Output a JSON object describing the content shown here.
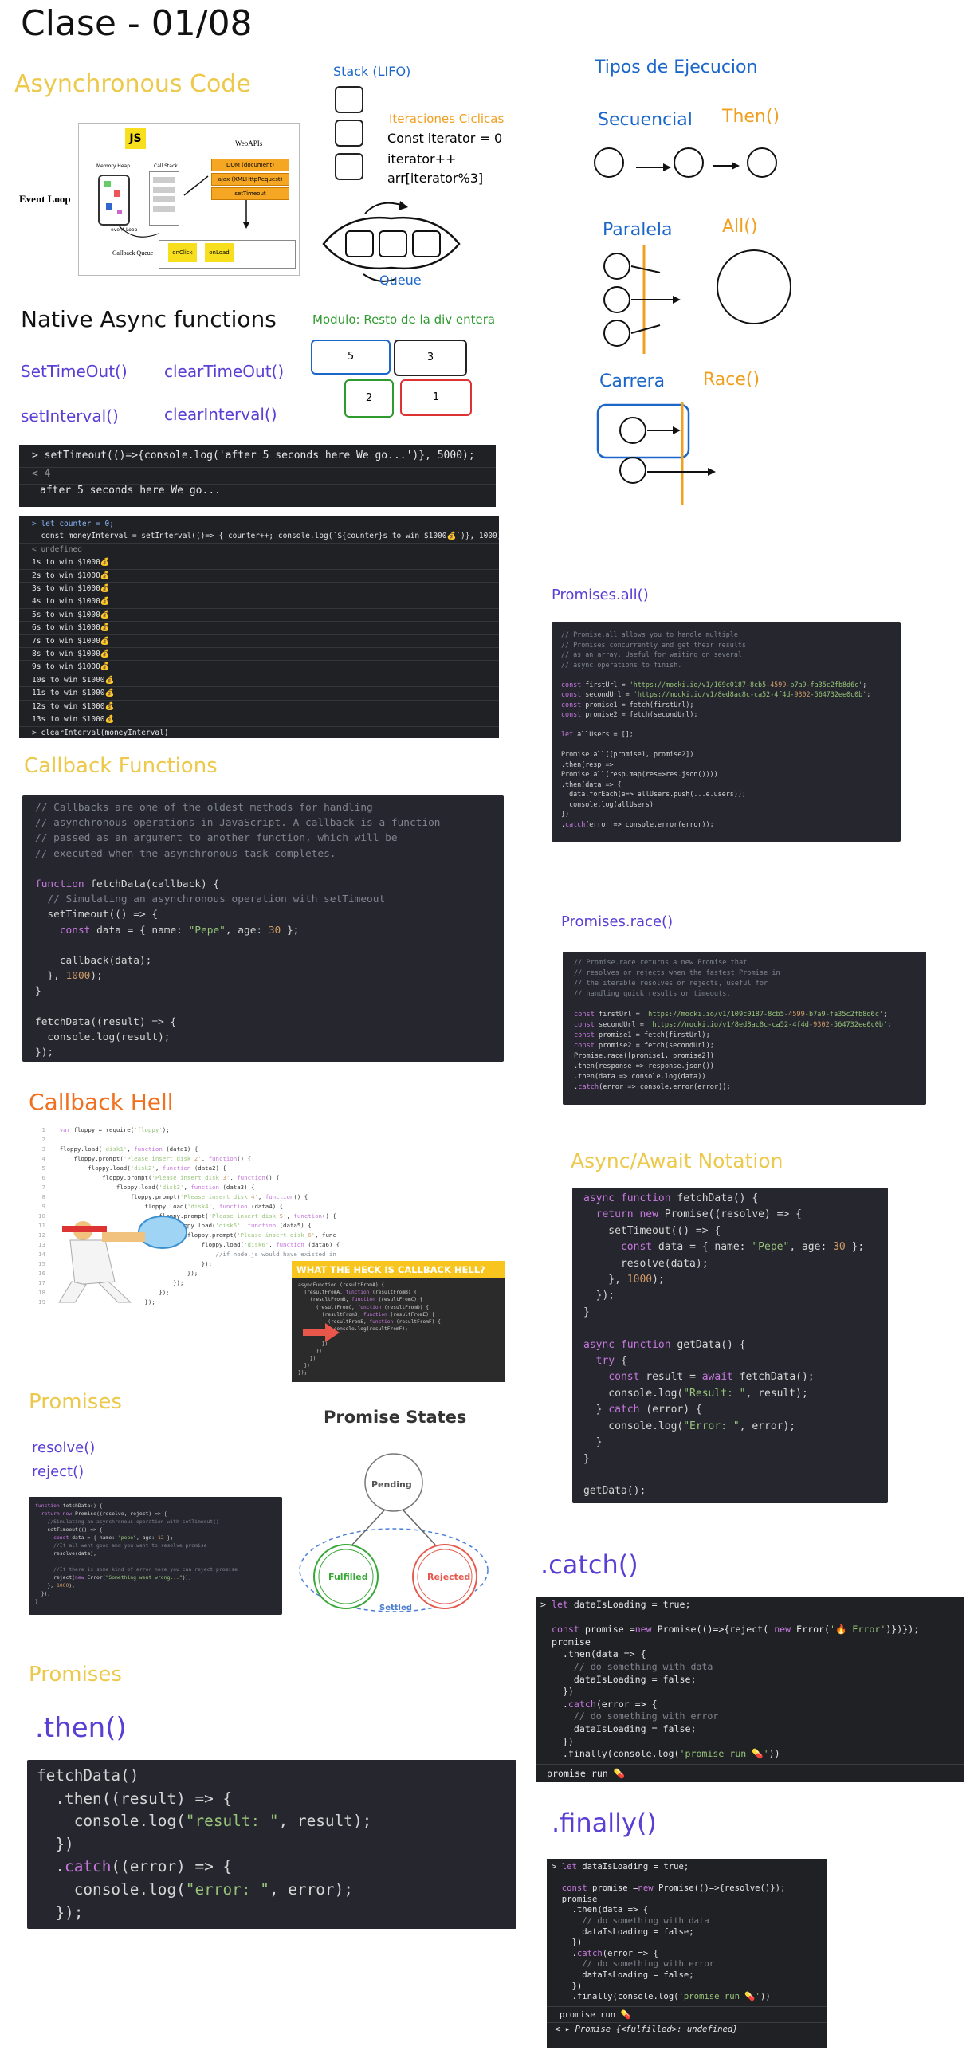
{
  "title": "Clase - 01/08",
  "async_code": {
    "heading": "Asynchronous Code",
    "event_loop_label": "Event Loop",
    "js_badge": "JS",
    "web_apis": "WebAPIs",
    "memory_heap": "Memory Heap",
    "call_stack": "Call Stack",
    "api_items": [
      "DOM (document)",
      "ajax (XMLHttpRequest)",
      "setTimeout"
    ],
    "event_loop_small": "event Loop",
    "callback_queue": "Callback Queue",
    "queue_items": [
      "onClick",
      "onLoad"
    ]
  },
  "stack": {
    "label": "Stack (LIFO)",
    "queue_label": "Queue"
  },
  "iteraciones": {
    "heading": "Iteraciones Ciclicas",
    "lines": [
      "Const iterator = 0",
      "iterator++",
      "arr[iterator%3]"
    ]
  },
  "tipos": {
    "heading": "Tipos de Ejecucion",
    "secuencial": "Secuencial",
    "then": "Then()",
    "paralela": "Paralela",
    "all": "All()",
    "carrera": "Carrera",
    "race": "Race()"
  },
  "native": {
    "heading": "Native Async functions",
    "items": [
      "SetTimeOut()",
      "clearTimeOut()",
      "setInterval()",
      "clearInterval()"
    ]
  },
  "modulo": {
    "heading": "Modulo: Resto de la div entera",
    "values": [
      "5",
      "3",
      "2",
      "1"
    ]
  },
  "console1": {
    "line1": "> setTimeout(()=>{console.log('after 5 seconds here We go...')}, 5000);",
    "line2": "< 4",
    "line3": "after 5 seconds here We go..."
  },
  "console2": {
    "header1": "> let counter = 0;",
    "header2": "  const moneyInterval = setInterval(()=> { counter++; console.log(`${counter}s to win $1000💰`)}, 1000);",
    "undefined": "< undefined",
    "lines": [
      "1s to win $1000💰",
      "2s to win $1000💰",
      "3s to win $1000💰",
      "4s to win $1000💰",
      "5s to win $1000💰",
      "6s to win $1000💰",
      "7s to win $1000💰",
      "8s to win $1000💰",
      "9s to win $1000💰",
      "10s to win $1000💰",
      "11s to win $1000💰",
      "12s to win $1000💰",
      "13s to win $1000💰"
    ],
    "footer": "> clearInterval(moneyInterval)"
  },
  "promises_all": {
    "heading": "Promises.all()",
    "code": [
      "// Promise.all allows you to handle multiple",
      "// Promises concurrently and get their results",
      "// as an array. Useful for waiting on several",
      "// async operations to finish.",
      "",
      "const firstUrl = 'https://mocki.io/v1/109c0187-8cb5-4599-b7a9-fa35c2fb8d6c';",
      "const secondUrl = 'https://mocki.io/v1/8ed8ac8c-ca52-4f4d-9302-564732ee0c0b';",
      "const promise1 = fetch(firstUrl);",
      "const promise2 = fetch(secondUrl);",
      "",
      "let allUsers = [];",
      "",
      "Promise.all([promise1, promise2])",
      ".then(resp =>",
      "Promise.all(resp.map(res=>res.json())))",
      ".then(data => {",
      "  data.forEach(e=> allUsers.push(...e.users));",
      "  console.log(allUsers)",
      "})",
      ".catch(error => console.error(error));"
    ]
  },
  "callback_fn": {
    "heading": "Callback Functions",
    "code": [
      "// Callbacks are one of the oldest methods for handling",
      "// asynchronous operations in JavaScript. A callback is a function",
      "// passed as an argument to another function, which will be",
      "// executed when the asynchronous task completes.",
      "",
      "function fetchData(callback) {",
      "  // Simulating an asynchronous operation with setTimeout",
      "  setTimeout(() => {",
      "    const data = { name: \"Pepe\", age: 30 };",
      "",
      "    callback(data);",
      "  }, 1000);",
      "}",
      "",
      "fetchData((result) => {",
      "  console.log(result);",
      "});"
    ]
  },
  "promises_race": {
    "heading": "Promises.race()",
    "code": [
      "// Promise.race returns a new Promise that",
      "// resolves or rejects when the fastest Promise in",
      "// the iterable resolves or rejects, useful for",
      "// handling quick results or timeouts.",
      "",
      "const firstUrl = 'https://mocki.io/v1/109c0187-8cb5-4599-b7a9-fa35c2fb8d6c';",
      "const secondUrl = 'https://mocki.io/v1/8ed8ac8c-ca52-4f4d-9302-564732ee0c0b';",
      "const promise1 = fetch(firstUrl);",
      "const promise2 = fetch(secondUrl);",
      "Promise.race([promise1, promise2])",
      ".then(response => response.json())",
      ".then(data => console.log(data))",
      ".catch(error => console.error(error));"
    ]
  },
  "callback_hell": {
    "heading": "Callback Hell",
    "code": [
      "var floppy = require('floppy');",
      "",
      "floppy.load('disk1', function (data1) {",
      "    floppy.prompt('Please insert disk 2', function() {",
      "        floppy.load('disk2', function (data2) {",
      "            floppy.prompt('Please insert disk 3', function() {",
      "                floppy.load('disk3', function (data3) {",
      "                    floppy.prompt('Please insert disk 4', function() {",
      "                        floppy.load('disk4', function (data4) {",
      "                            floppy.prompt('Please insert disk 5', function() {",
      "                                floppy.load('disk5', function (data5) {",
      "                                    floppy.prompt('Please insert disk 6', func",
      "                                        floppy.load('disk6', function (data6) {",
      "                                            //if node.js would have existed in",
      "                                        });",
      "                                    });",
      "                                });",
      "                            });",
      "                        });"
    ],
    "banner": "WHAT THE HECK IS CALLBACK HELL?",
    "banner_code": [
      "asyncFunction (resultFromA) {",
      "  (resultFromA, function (resultFromB) {",
      "    (resultFromB, function (resultFromC) {",
      "      (resultFromC, function (resultFromD) {",
      "        (resultFromD, function (resultFromE) {",
      "          (resultFromE, function (resultFromF) {",
      "            console.log(resultFromF);",
      "          })",
      "        })",
      "      })",
      "    })",
      "  })",
      "});"
    ]
  },
  "async_await": {
    "heading": "Async/Await Notation",
    "code": [
      "async function fetchData() {",
      "  return new Promise((resolve) => {",
      "    setTimeout(() => {",
      "      const data = { name: \"Pepe\", age: 30 };",
      "      resolve(data);",
      "    }, 1000);",
      "  });",
      "}",
      "",
      "async function getData() {",
      "  try {",
      "    const result = await fetchData();",
      "    console.log(\"Result: \", result);",
      "  } catch (error) {",
      "    console.log(\"Error: \", error);",
      "  }",
      "}",
      "",
      "getData();"
    ]
  },
  "promises": {
    "heading": "Promises",
    "resolve": "resolve()",
    "reject": "reject()",
    "code": [
      "function fetchData() {",
      "  return new Promise((resolve, reject) => {",
      "    //Simulating an asynchronous operation with setTimeout()",
      "    setTimeout(() => {",
      "      const data = { name: \"pepe\", age: 12 };",
      "      //If all went good and you want to resolve promise",
      "      resolve(data);",
      "",
      "      //If there is some kind of error here you can reject promise",
      "      reject(new Error(\"Something went wrong...\"));",
      "    }, 1000);",
      "  });",
      "}"
    ],
    "states_title": "Promise States",
    "pending": "Pending",
    "fulfilled": "Fulfilled",
    "rejected": "Rejected",
    "settled": "Settled"
  },
  "promises2": {
    "heading": "Promises",
    "then_heading": ".then()",
    "code": [
      "fetchData()",
      "  .then((result) => {",
      "    console.log(\"result: \", result);",
      "  })",
      "  .catch((error) => {",
      "    console.log(\"error: \", error);",
      "  });"
    ]
  },
  "catch": {
    "heading": ".catch()",
    "code": [
      "> let dataIsLoading = true;",
      "",
      "  const promise =new Promise(()=>{reject( new Error('🔥 Error')})});",
      "  promise",
      "    .then(data => {",
      "      // do something with data",
      "      dataIsLoading = false;",
      "    })",
      "    .catch(error => {",
      "      // do something with error",
      "      dataIsLoading = false;",
      "    })",
      "    .finally(console.log('promise run 💊'))"
    ],
    "output": "promise run 💊"
  },
  "finally": {
    "heading": ".finally()",
    "code": [
      "> let dataIsLoading = true;",
      "",
      "  const promise =new Promise(()=>{resolve()});",
      "  promise",
      "    .then(data => {",
      "      // do something with data",
      "      dataIsLoading = false;",
      "    })",
      "    .catch(error => {",
      "      // do something with error",
      "      dataIsLoading = false;",
      "    })",
      "    .finally(console.log('promise run 💊'))"
    ],
    "output": "promise run 💊",
    "result": "< ▸ Promise {<fulfilled>: undefined}"
  }
}
